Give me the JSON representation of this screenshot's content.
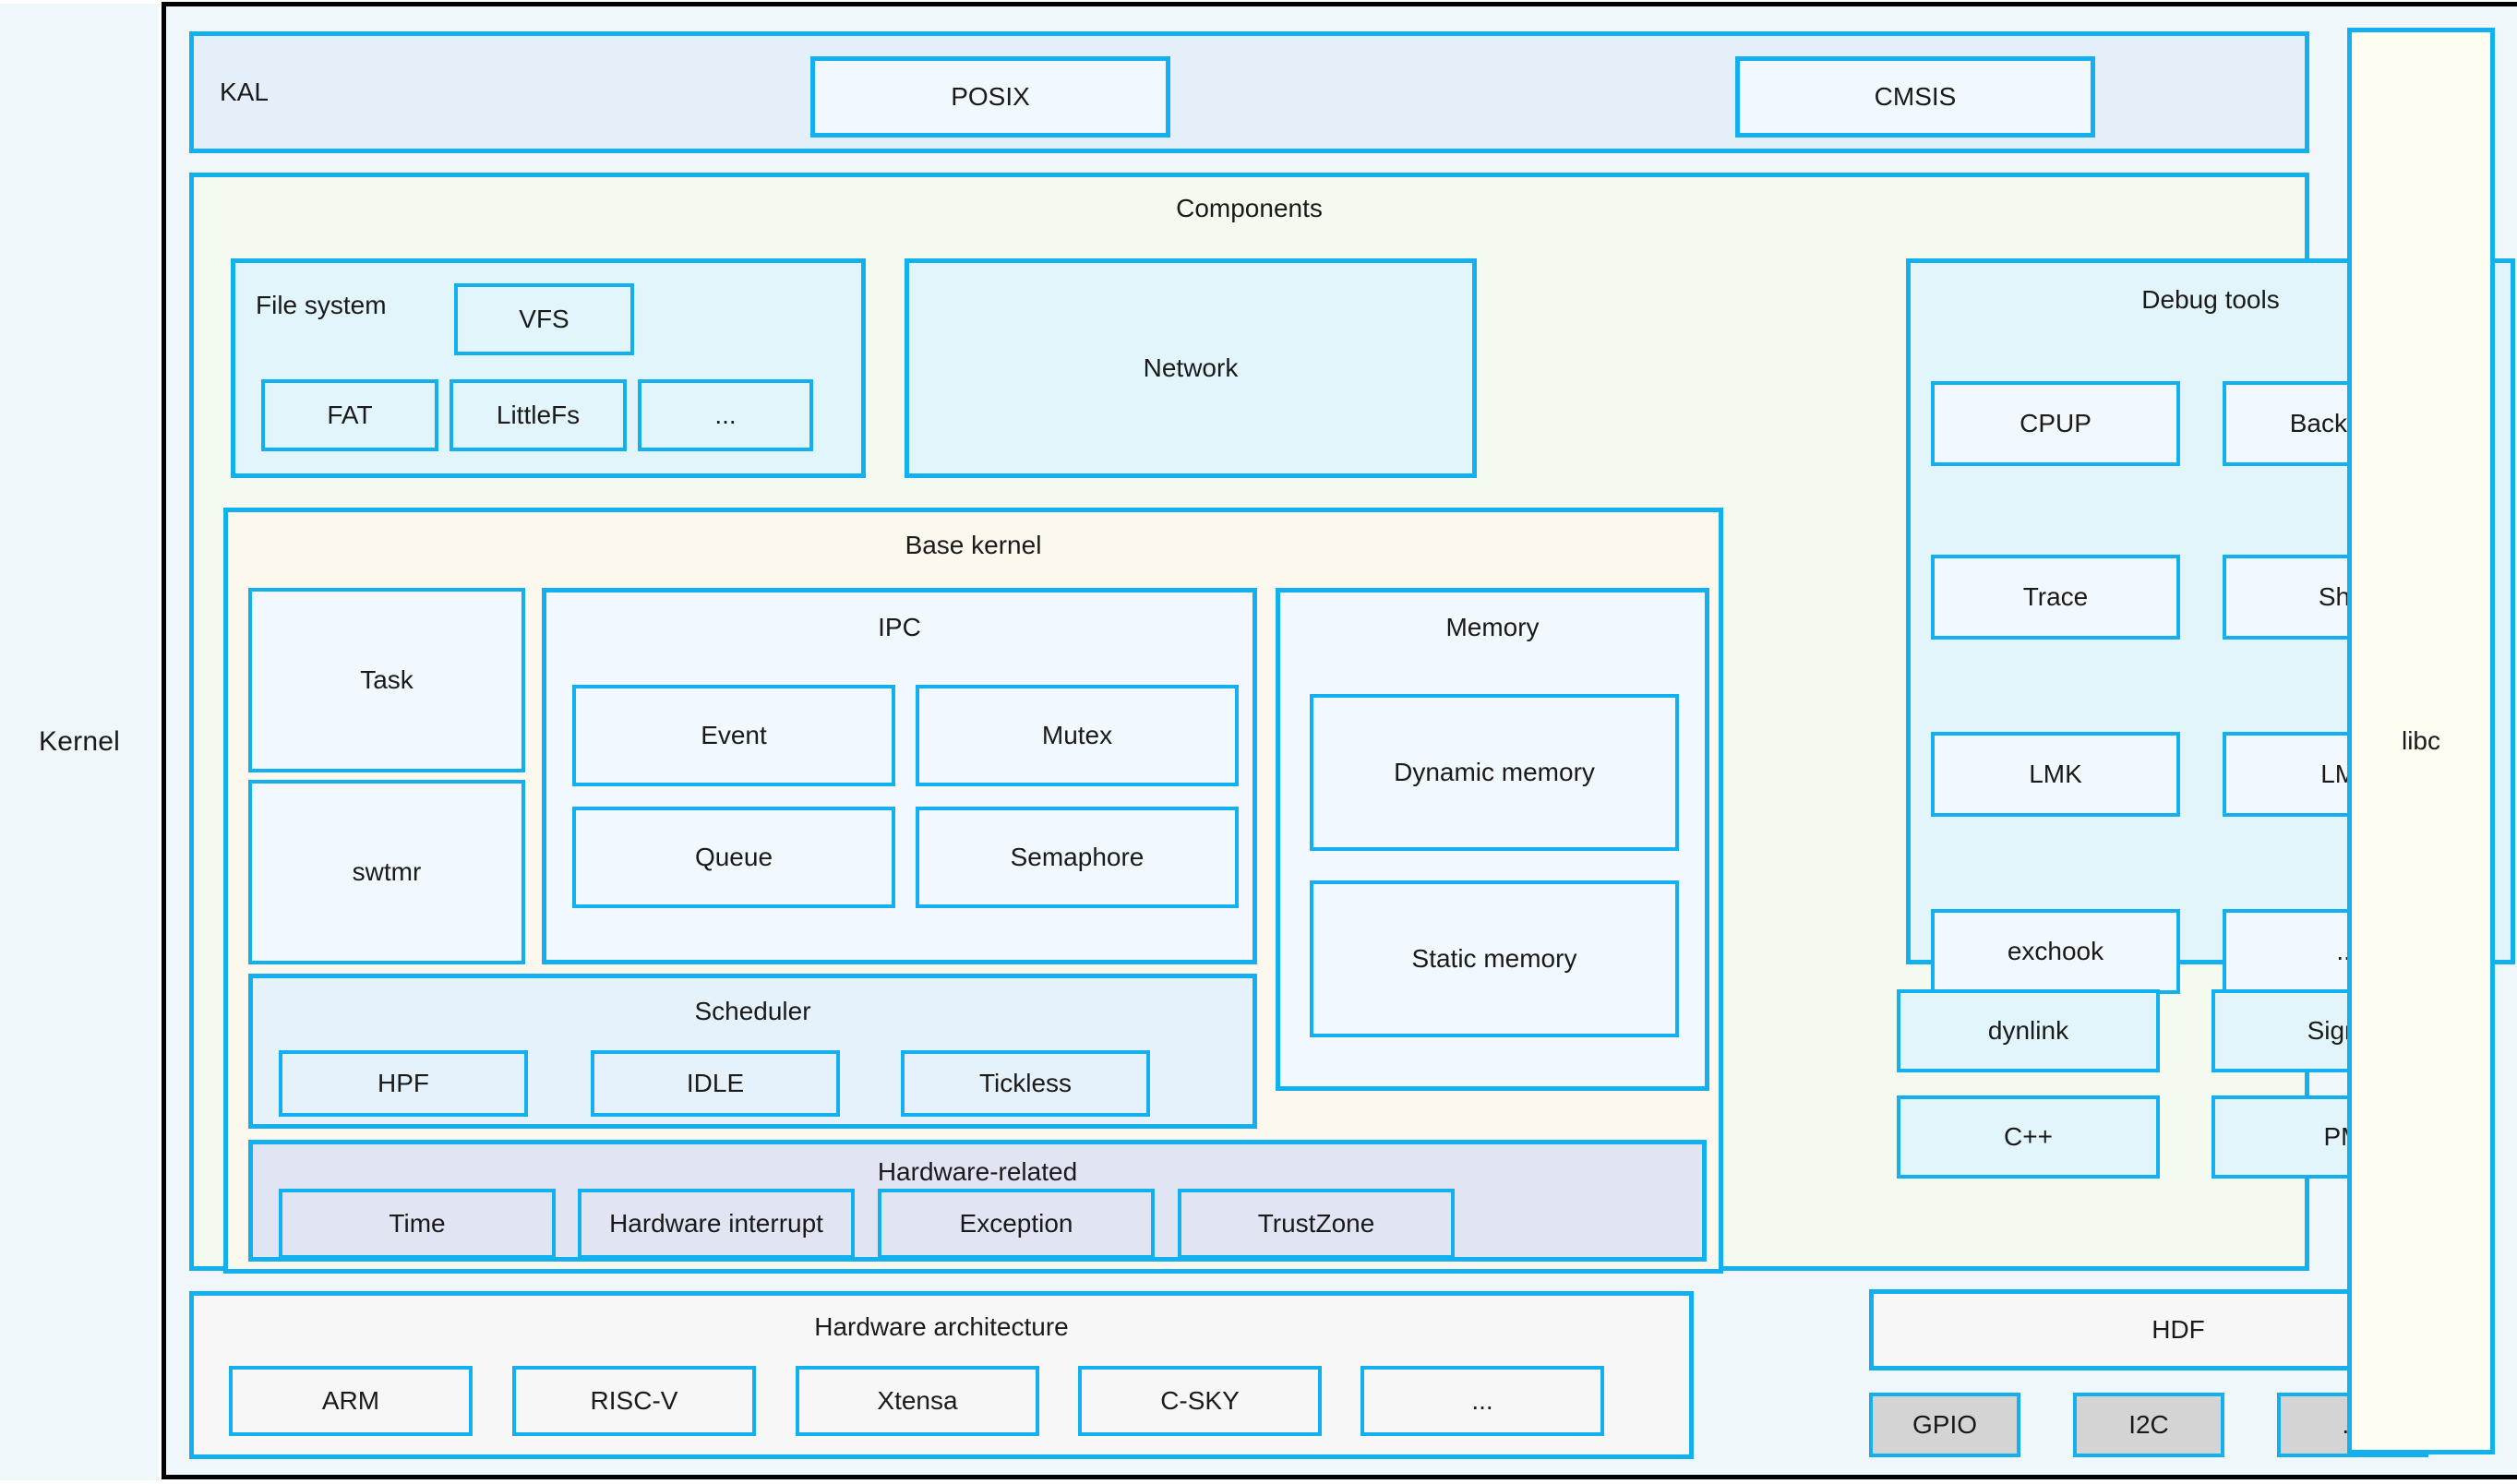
{
  "left_rail": {
    "label": "Kernel"
  },
  "right_rail": {
    "label": "libc"
  },
  "kal_row": {
    "label": "KAL",
    "boxes": [
      {
        "label": "POSIX"
      },
      {
        "label": "CMSIS"
      }
    ]
  },
  "components": {
    "title": "Components",
    "file_system": {
      "label": "File system",
      "items": [
        {
          "label": "VFS"
        },
        {
          "label": "FAT"
        },
        {
          "label": "LittleFs"
        },
        {
          "label": "..."
        }
      ]
    },
    "network": {
      "label": "Network"
    },
    "debug_tools": {
      "title": "Debug tools",
      "items": [
        {
          "label": "CPUP"
        },
        {
          "label": "Backtrace"
        },
        {
          "label": "Trace"
        },
        {
          "label": "Shell"
        },
        {
          "label": "LMK"
        },
        {
          "label": "LMS"
        },
        {
          "label": "exchook"
        },
        {
          "label": "..."
        }
      ]
    },
    "extras": [
      {
        "label": "dynlink"
      },
      {
        "label": "Signal"
      },
      {
        "label": "C++"
      },
      {
        "label": "PM"
      }
    ],
    "base_kernel": {
      "title": "Base kernel",
      "task": {
        "label": "Task"
      },
      "swtmr": {
        "label": "swtmr"
      },
      "ipc": {
        "title": "IPC",
        "items": [
          {
            "label": "Event"
          },
          {
            "label": "Mutex"
          },
          {
            "label": "Queue"
          },
          {
            "label": "Semaphore"
          }
        ]
      },
      "memory": {
        "title": "Memory",
        "items": [
          {
            "label": "Dynamic memory"
          },
          {
            "label": "Static memory"
          }
        ]
      },
      "scheduler": {
        "title": "Scheduler",
        "items": [
          {
            "label": "HPF"
          },
          {
            "label": "IDLE"
          },
          {
            "label": "Tickless"
          }
        ]
      },
      "hardware_related": {
        "title": "Hardware-related",
        "items": [
          {
            "label": "Time"
          },
          {
            "label": "Hardware interrupt"
          },
          {
            "label": "Exception"
          },
          {
            "label": "TrustZone"
          }
        ]
      }
    }
  },
  "hardware_architecture": {
    "title": "Hardware architecture",
    "items": [
      {
        "label": "ARM"
      },
      {
        "label": "RISC-V"
      },
      {
        "label": "Xtensa"
      },
      {
        "label": "C-SKY"
      },
      {
        "label": "..."
      }
    ]
  },
  "hdf": {
    "label": "HDF"
  },
  "bus_drivers": [
    {
      "label": "GPIO"
    },
    {
      "label": "I2C"
    },
    {
      "label": "..."
    }
  ],
  "colors": {
    "border": "#12b0ef",
    "frame": "#000000",
    "rail_bg": "#eff7fa",
    "components_bg": "#f5faf1",
    "base_kernel_bg": "#fdf8ee",
    "hardware_related_bg": "#e1e5f3",
    "libc_bg": "#fffcf2",
    "bus_bg": "#d4d4d4"
  }
}
